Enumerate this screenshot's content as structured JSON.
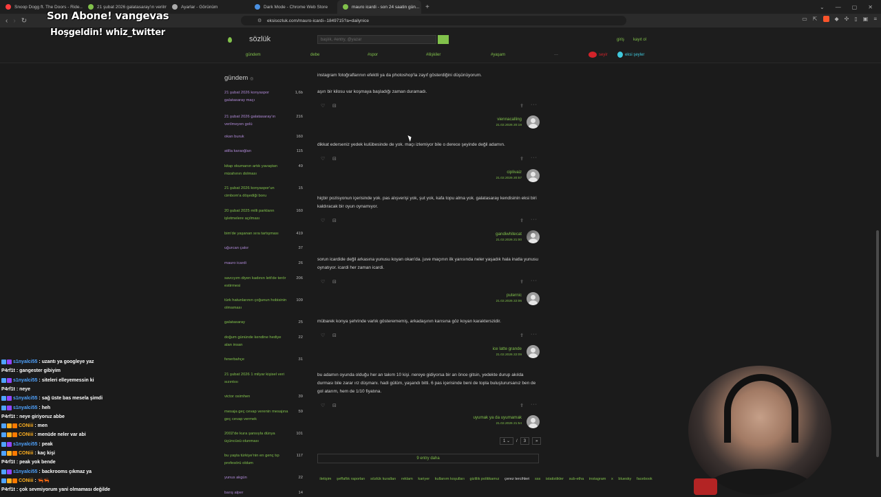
{
  "browser": {
    "tabs": [
      {
        "title": "Snoop Dogg ft. The Doors - Ride...",
        "icon_color": "#ff3d3d",
        "icon": "youtube-icon",
        "active": false
      },
      {
        "title": "21 şubat 2026 galatasaray'ın verilmey...",
        "icon_color": "#81c14b",
        "icon": "eksi-icon",
        "active": false
      },
      {
        "title": "Ayarlar - Görünüm",
        "icon_color": "#aaaaaa",
        "icon": "gear-icon",
        "active": false
      },
      {
        "title": "Dark Mode - Chrome Web Store",
        "icon_color": "#4a90e2",
        "icon": "store-icon",
        "active": false
      },
      {
        "title": "mauro icardi - son 24 saatin gün...",
        "icon_color": "#81c14b",
        "icon": "eksi-icon",
        "active": true
      }
    ],
    "url": "eksisozluk.com/mauro-icardi--1849715?a=dailynice"
  },
  "overlay": {
    "line1": "Son Abone! vangevas",
    "line2": "Hoşgeldin! whiz_twitter"
  },
  "header": {
    "logo": "sözlük",
    "search_placeholder": "başlık, #entry, @yazar",
    "login": "giriş",
    "register": "kayıt ol",
    "nav": [
      "gündem",
      "debe",
      "#spor",
      "#ilişkiler",
      "#yaşam",
      "···"
    ],
    "youtube_label": "seyir",
    "drop_label": "eksi şeyler"
  },
  "sidebar": {
    "title": "gündem",
    "items": [
      {
        "title": "21 şubat 2026 konyaspor galatasaray maçı",
        "count": "1,6b",
        "visited": true
      },
      {
        "title": "21 şubat 2026 galatasaray'ın verilmeyen golü",
        "count": "216",
        "visited": true
      },
      {
        "title": "okan buruk",
        "count": "160",
        "visited": true
      },
      {
        "title": "atilla karaoğlan",
        "count": "115",
        "visited": true
      },
      {
        "title": "kitap okumanın artık yavaştan mizahının dolması",
        "count": "49",
        "visited": false
      },
      {
        "title": "21 şubat 2026 konyaspor'un cimbom'a döşediği boru",
        "count": "15",
        "visited": false
      },
      {
        "title": "20 şubat 2025 milli parkların işletmelere açılması",
        "count": "160",
        "visited": false
      },
      {
        "title": "bim'de yaşanan sıra tartışması",
        "count": "419",
        "visited": false
      },
      {
        "title": "uğurcan çakır",
        "count": "37",
        "visited": true
      },
      {
        "title": "mauro icardi",
        "count": "26",
        "visited": true
      },
      {
        "title": "savcıyım diyen kadının lett'de terör estirmesi",
        "count": "206",
        "visited": false
      },
      {
        "title": "türk hatunlarının çoğunun hobisinin olmaması",
        "count": "109",
        "visited": false
      },
      {
        "title": "galatasaray",
        "count": "25",
        "visited": false
      },
      {
        "title": "doğum gününde kendine hediye alan insan",
        "count": "22",
        "visited": false
      },
      {
        "title": "fenerbahçe",
        "count": "31",
        "visited": false
      },
      {
        "title": "21 şubat 2026 1 milyar kişisel veri sızıntısı",
        "count": "",
        "visited": false
      },
      {
        "title": "victor osimhen",
        "count": "39",
        "visited": false
      },
      {
        "title": "mesaja geç cevap verenin mesajına geç cevap vermek",
        "count": "59",
        "visited": false
      },
      {
        "title": "2002'de kura şansıyla dünya üçüncüsü olunması",
        "count": "101",
        "visited": false
      },
      {
        "title": "bu yaşta türkiye'nin en genç tıp profesörü oldum",
        "count": "117",
        "visited": false
      },
      {
        "title": "yunus akgün",
        "count": "22",
        "visited": true
      },
      {
        "title": "barış alper",
        "count": "14",
        "visited": true
      }
    ]
  },
  "entries": [
    {
      "text": "instagram fotoğraflarının efektli ya da photoshop'la zayıf gösterdiğini düşünüyorum.\n\naşırı bir kilosu var koşmaya başladığı zaman duramadı.",
      "author": "viennacalling",
      "date": "21.02.2026 20:19",
      "photo": false
    },
    {
      "text": "dikkat ederseniz yedek kulübesinde de yok. maçı izlemiyor bile o derece şeyinde değil adamın.",
      "author": "ciplivaiz",
      "date": "21.02.2026 20:57",
      "photo": false
    },
    {
      "text": "hiçbir pozisyonun içerisinde yok. pas alışverişi yok, şut yok, kafa topu alma yok. galatasaray kendisinin eksi biri kaldıracak bir oyun oynamıyor.",
      "author": "gandiwhitecat",
      "date": "21.02.2026 21:00",
      "photo": true
    },
    {
      "text": "sorun icardide değil arkasına yunusu koyan okan'da. juve maçının ilk yarısında neler yaşadık hala inatla yunusu oynatıyor. icardi her zaman icardi.",
      "author": "puternic",
      "date": "21.02.2026 22:06",
      "photo": false
    },
    {
      "text": "mübarek konya şehrinde varlık gösterememiş, arkadaşının karısına göz koyan karakterszidir.",
      "author": "ice latte grande",
      "date": "21.02.2026 22:09",
      "photo": false
    },
    {
      "text": "bu adamın oyunda olduğu her an takım 10 kişi. nereye gidiyorsa bir an önce gitsin, yedekte durup akılda durması bile zarar ırz düşmanı. hadi gülüm, yaşandı bitti. 6 pas içerisinde beni de topla buluşturursanız ben de gol atarım, hem de 1/10 fiyatına.",
      "author": "uyumak ya da uyumamak",
      "date": "21.02.2026 21:54",
      "photo": false
    }
  ],
  "pager": {
    "current": "1",
    "sep": "/",
    "total": "3",
    "next": "»"
  },
  "more_entries": "9 entry daha",
  "footer": {
    "links": [
      "iletişim",
      "şeffaflık raporları",
      "sözlük kuralları",
      "reklam",
      "kariyer",
      "kullanım koşulları",
      "gizlilik politikamız",
      "çerez tercihleri",
      "sss",
      "istatistikler",
      "sub-etha",
      "instagram",
      "x",
      "bluesky",
      "facebook"
    ]
  },
  "chat": [
    {
      "user": "s1nyalci55",
      "msg": ": uzantı ya googleye yaz",
      "color": "#4fa3ff",
      "badges": [
        "#4fa3ff",
        "#9146ff"
      ]
    },
    {
      "user": "P4rf1t",
      "msg": ": gangester gibiyim",
      "color": "#ffffff",
      "badges": []
    },
    {
      "user": "s1nyalci55",
      "msg": ": siteleri elleyemessin ki",
      "color": "#4fa3ff",
      "badges": [
        "#4fa3ff",
        "#9146ff"
      ]
    },
    {
      "user": "P4rf1t",
      "msg": ": neye",
      "color": "#ffffff",
      "badges": []
    },
    {
      "user": "s1nyalci55",
      "msg": ": sağ üste bas mesela şimdi",
      "color": "#4fa3ff",
      "badges": [
        "#4fa3ff",
        "#9146ff"
      ]
    },
    {
      "user": "s1nyalci55",
      "msg": ": heh",
      "color": "#4fa3ff",
      "badges": [
        "#4fa3ff",
        "#9146ff"
      ]
    },
    {
      "user": "P4rf1t",
      "msg": ": neye giriyoruz abbe",
      "color": "#ffffff",
      "badges": []
    },
    {
      "user": "CONiii",
      "msg": ": men",
      "color": "#ffb020",
      "badges": [
        "#4fa3ff",
        "#ffb020",
        "#ff7a00"
      ]
    },
    {
      "user": "CONiii",
      "msg": ": menüde neler var abi",
      "color": "#ffb020",
      "badges": [
        "#4fa3ff",
        "#ffb020",
        "#ff7a00"
      ]
    },
    {
      "user": "s1nyalci55",
      "msg": ": peak",
      "color": "#4fa3ff",
      "badges": [
        "#4fa3ff",
        "#9146ff"
      ]
    },
    {
      "user": "CONiii",
      "msg": ": kaç kişi",
      "color": "#ffb020",
      "badges": [
        "#4fa3ff",
        "#ffb020",
        "#ff7a00"
      ]
    },
    {
      "user": "P4rf1t",
      "msg": ": peak yok bende",
      "color": "#ffffff",
      "badges": []
    },
    {
      "user": "s1nyalci55",
      "msg": ": backrooms çıkmaz ya",
      "color": "#4fa3ff",
      "badges": [
        "#4fa3ff",
        "#9146ff"
      ]
    },
    {
      "user": "CONiii",
      "msg": ": 🦐🦐",
      "color": "#ffb020",
      "badges": [
        "#4fa3ff",
        "#ffb020",
        "#ff7a00"
      ]
    },
    {
      "user": "P4rf1t",
      "msg": ": çok sevmiyorum yani olmaması değilde",
      "color": "#ffffff",
      "badges": []
    }
  ],
  "colors": {
    "accent": "#81c14b",
    "visited": "#b08ad8",
    "background": "#1b1b1b"
  }
}
